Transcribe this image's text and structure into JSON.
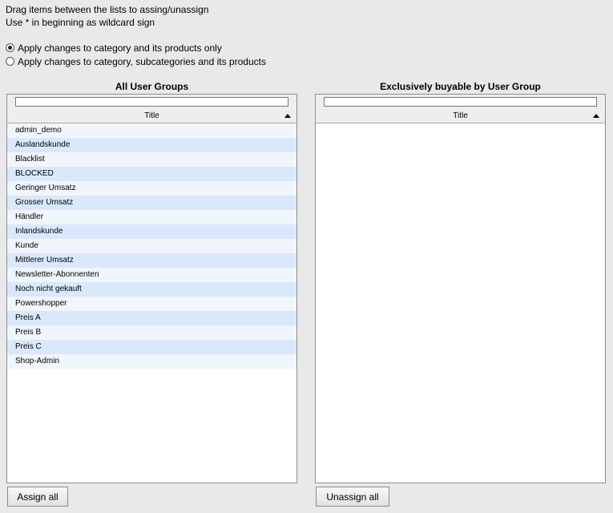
{
  "help": {
    "line1": "Drag items between the lists to assing/unassign",
    "line2": "Use * in beginning as wildcard sign"
  },
  "options": {
    "opt1": {
      "label": "Apply changes to category and its products only",
      "checked": true
    },
    "opt2": {
      "label": "Apply changes to category, subcategories and its products",
      "checked": false
    }
  },
  "left": {
    "title": "All User Groups",
    "filter_value": "",
    "column": "Title",
    "items": [
      "admin_demo",
      "Auslandskunde",
      "Blacklist",
      "BLOCKED",
      "Geringer Umsatz",
      "Grosser Umsatz",
      "Händler",
      "Inlandskunde",
      "Kunde",
      "Mittlerer Umsatz",
      "Newsletter-Abonnenten",
      "Noch nicht gekauft",
      "Powershopper",
      "Preis A",
      "Preis B",
      "Preis C",
      "Shop-Admin"
    ],
    "button": "Assign all"
  },
  "right": {
    "title": "Exclusively buyable by User Group",
    "filter_value": "",
    "column": "Title",
    "items": [],
    "button": "Unassign all"
  },
  "colors": {
    "background": "#e8e9eb",
    "row_odd": "#f1f5fc",
    "row_even": "#dae8fb"
  }
}
